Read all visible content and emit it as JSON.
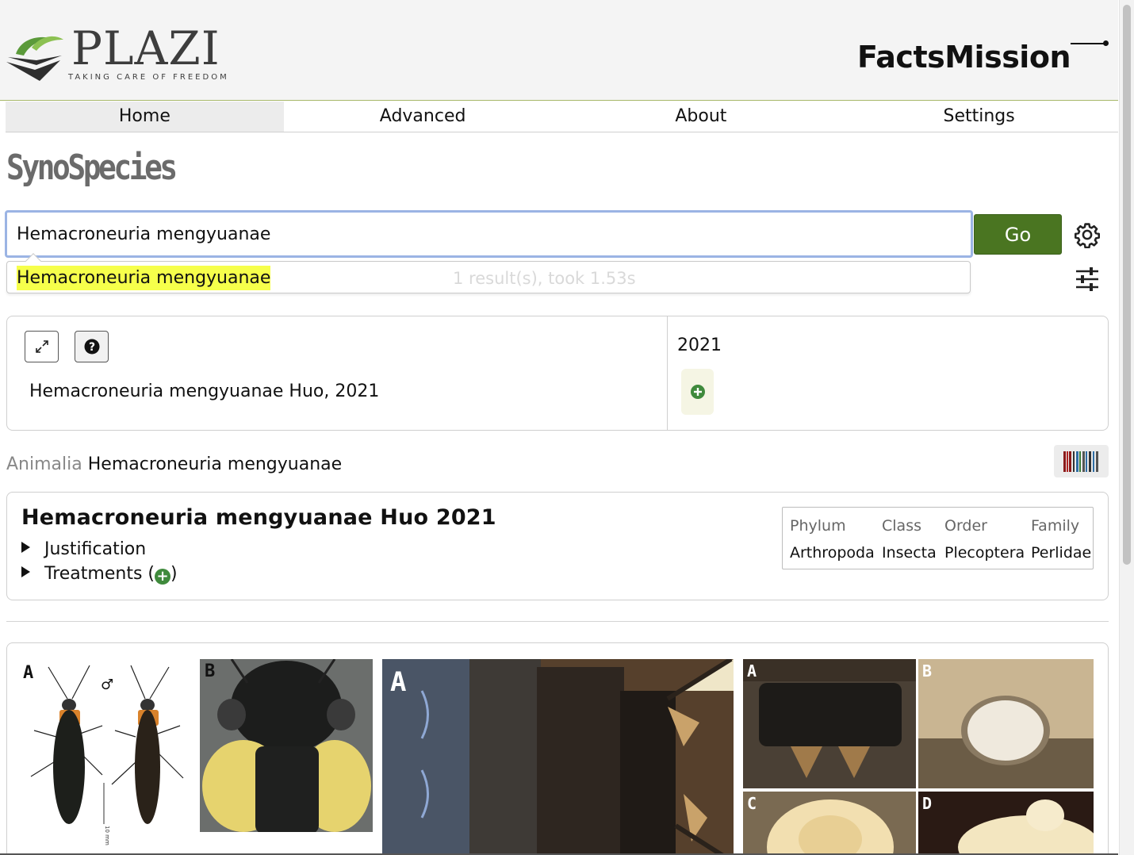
{
  "header": {
    "logo_name": "PLAZI",
    "logo_tagline": "TAKING CARE OF FREEDOM",
    "partner_logo": "FactsMission"
  },
  "nav": {
    "items": [
      {
        "label": "Home",
        "active": true
      },
      {
        "label": "Advanced",
        "active": false
      },
      {
        "label": "About",
        "active": false
      },
      {
        "label": "Settings",
        "active": false
      }
    ]
  },
  "page": {
    "title": "SynoSpecies"
  },
  "search": {
    "value": "Hemacroneuria mengyuanae",
    "go_label": "Go",
    "settings_icon": "gear-icon",
    "filter_icon": "sliders-icon",
    "suggestion": "Hemacroneuria mengyuanae",
    "result_stats": "1 result(s), took 1.53s"
  },
  "result_card": {
    "expand_icon": "expand-icon",
    "help_icon": "question-icon",
    "name": "Hemacroneuria mengyuanae Huo, 2021",
    "year": "2021",
    "add_icon": "plus-circle-icon"
  },
  "breadcrumb": {
    "kingdom": "Animalia",
    "species": "Hemacroneuria mengyuanae",
    "barcode_icon": "barcode-icon"
  },
  "taxon": {
    "title": "Hemacroneuria mengyuanae Huo 2021",
    "justification_label": "Justification",
    "treatments_label": "Treatments (",
    "treatments_close": ")",
    "classification": {
      "headers": [
        "Phylum",
        "Class",
        "Order",
        "Family"
      ],
      "values": [
        "Arthropoda",
        "Insecta",
        "Plecoptera",
        "Perlidae"
      ]
    }
  },
  "figures": [
    {
      "label": "A",
      "subject": "male and female habitus"
    },
    {
      "label": "B",
      "subject": "head and pronotum"
    },
    {
      "label": "A",
      "subject": "abdomen dorsal"
    },
    {
      "label": "A",
      "subject": "terminalia"
    },
    {
      "label": "B",
      "subject": "subgenital plate"
    },
    {
      "label": "C",
      "subject": "aedeagus"
    },
    {
      "label": "D",
      "subject": "aedeagus lateral"
    }
  ],
  "figure_extra": {
    "male_symbol": "♂",
    "scale_text": "10 mm"
  },
  "colors": {
    "accent_green": "#4a7521",
    "highlight_yellow": "#f6ff4b",
    "plus_green": "#3f8a3c"
  }
}
